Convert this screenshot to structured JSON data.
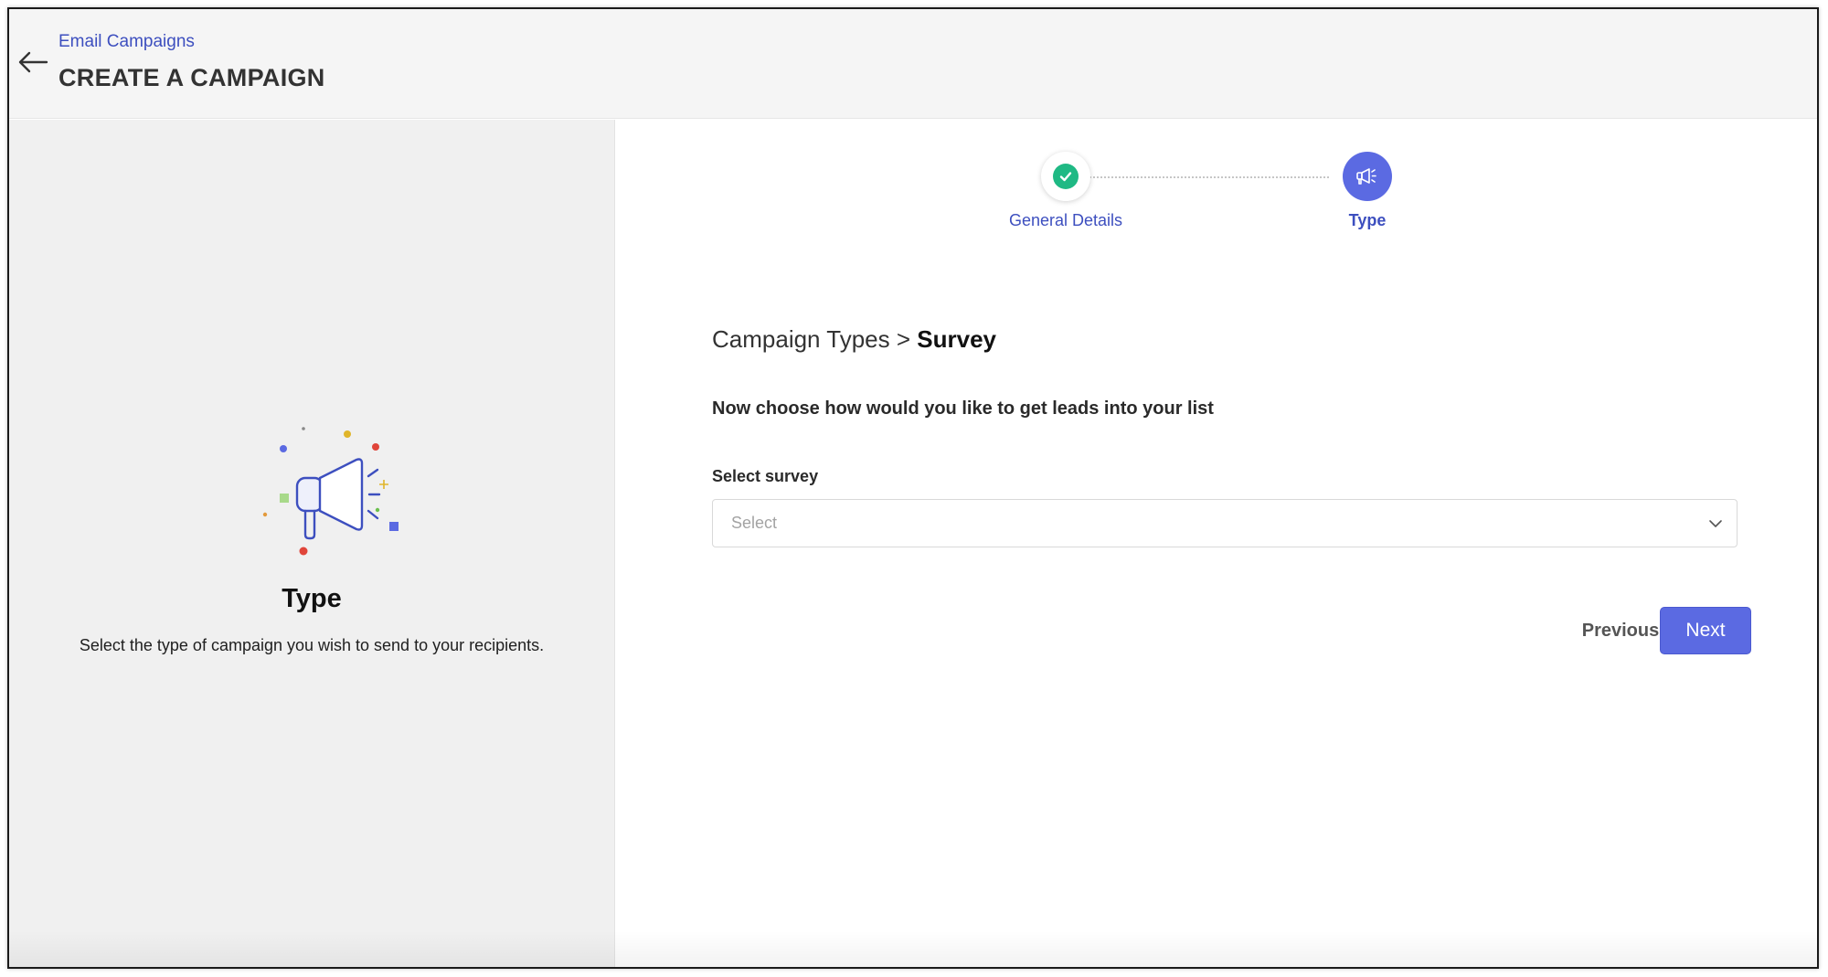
{
  "header": {
    "breadcrumb_link": "Email Campaigns",
    "title": "CREATE A CAMPAIGN",
    "back_icon": "arrow-left-icon"
  },
  "left_panel": {
    "illustration_icon": "megaphone-icon",
    "title": "Type",
    "description": "Select the type of campaign you wish to send to your recipients."
  },
  "stepper": {
    "steps": [
      {
        "label": "General Details",
        "status": "completed",
        "icon": "check-icon"
      },
      {
        "label": "Type",
        "status": "active",
        "icon": "megaphone-icon"
      }
    ]
  },
  "main": {
    "breadcrumb_parent": "Campaign Types",
    "breadcrumb_separator": ">",
    "breadcrumb_current": "Survey",
    "instruction": "Now choose how would you like to get leads into your list",
    "survey_field": {
      "label": "Select survey",
      "placeholder": "Select",
      "value": ""
    },
    "buttons": {
      "previous": "Previous",
      "next": "Next"
    }
  },
  "colors": {
    "accent": "#5b6ae2",
    "link": "#3d4fbf",
    "success": "#1fb984",
    "left_panel_bg": "#f0f0f0",
    "header_bg": "#f5f5f5"
  }
}
